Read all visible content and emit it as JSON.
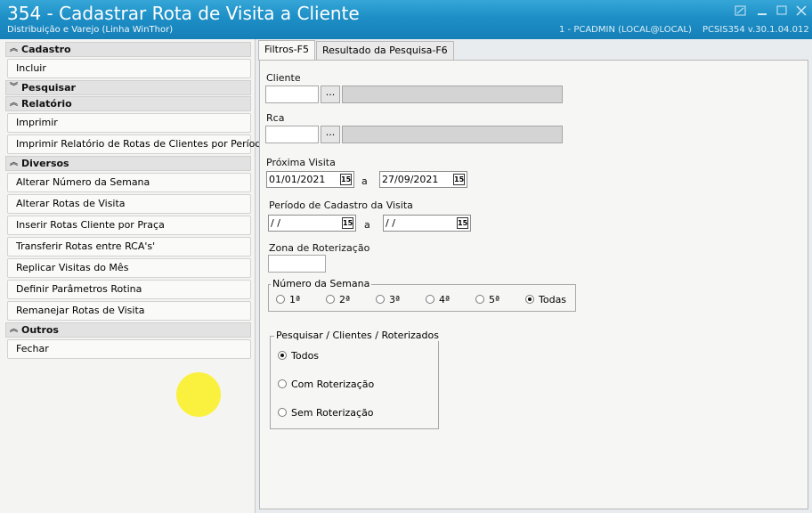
{
  "window": {
    "title": "354 - Cadastrar Rota de Visita a Cliente",
    "subtitle": "Distribuição e Varejo (Linha WinThor)",
    "user_info": "1 - PCADMIN (LOCAL@LOCAL)",
    "app_version": "PCSIS354  v.30.1.04.012",
    "controls": [
      "pin-icon",
      "minimize-icon",
      "maximize-icon",
      "close-icon"
    ]
  },
  "sidebar": {
    "groups": [
      {
        "label": "Cadastro",
        "expanded": true,
        "items": [
          "Incluir"
        ]
      },
      {
        "label": "Pesquisar",
        "expanded": false,
        "items": []
      },
      {
        "label": "Relatório",
        "expanded": true,
        "items": [
          "Imprimir",
          "Imprimir Relatório de Rotas de Clientes por Período"
        ]
      },
      {
        "label": "Diversos",
        "expanded": true,
        "items": [
          "Alterar Número da Semana",
          "Alterar Rotas de Visita",
          "Inserir Rotas Cliente por Praça",
          "Transferir Rotas entre RCA's'",
          "Replicar Visitas do Mês",
          "Definir Parâmetros Rotina",
          "Remanejar Rotas de Visita"
        ]
      },
      {
        "label": "Outros",
        "expanded": true,
        "items": [
          "Fechar"
        ]
      }
    ]
  },
  "tabs": [
    {
      "label": "Filtros-F5",
      "active": true
    },
    {
      "label": "Resultado da Pesquisa-F6",
      "active": false
    }
  ],
  "filters": {
    "cliente_label": "Cliente",
    "rca_label": "Rca",
    "lookup_button": "...",
    "proxima_visita_label": "Próxima Visita",
    "proxima_visita_from": "01/01/2021",
    "proxima_visita_to": "27/09/2021",
    "range_separator": "a",
    "periodo_label": "Período de Cadastro da Visita",
    "periodo_from": " / /",
    "periodo_to": " / /",
    "zona_label": "Zona de Roterização",
    "calendar_glyph": "15",
    "semana_legend": "Número da Semana",
    "semana_options": [
      "1ª",
      "2ª",
      "3ª",
      "4ª",
      "5ª",
      "Todas"
    ],
    "semana_selected": "Todas",
    "pesquisar_legend": "Pesquisar / Clientes / Roterizados",
    "pesquisar_options": [
      "Todos",
      "Com Roterização",
      "Sem Roterização"
    ],
    "pesquisar_selected": "Todos"
  },
  "colors": {
    "titlebar": "#1d8fc6",
    "cursor_highlight": "#faf01e"
  }
}
